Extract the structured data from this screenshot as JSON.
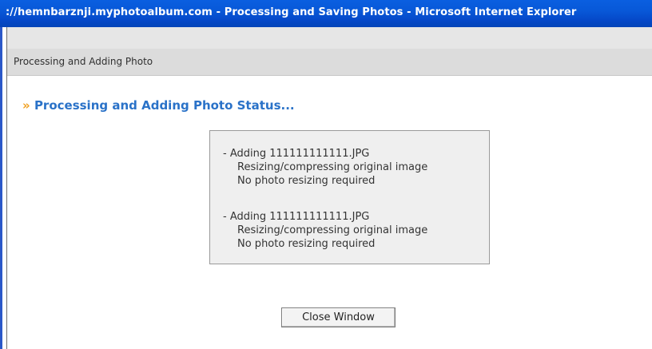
{
  "window": {
    "title": "://hemnbarznji.myphotoalbum.com - Processing and Saving Photos - Microsoft Internet Explorer"
  },
  "header": {
    "label": "Processing and Adding Photo"
  },
  "status": {
    "heading_prefix": "»",
    "heading": "Processing and Adding Photo Status..."
  },
  "log": {
    "entries": [
      {
        "adding": "- Adding 111111111111.JPG",
        "step": "Resizing/compressing original image",
        "result": "No photo resizing required"
      },
      {
        "adding": "- Adding 111111111111.JPG",
        "step": "Resizing/compressing original image",
        "result": "No photo resizing required"
      }
    ]
  },
  "actions": {
    "close_label": "Close Window"
  },
  "colors": {
    "titlebar": "#0858d8",
    "heading": "#2a72c8",
    "chevron": "#f0a020",
    "log_bg": "#efefef",
    "header_bar": "#dcdcdc"
  }
}
